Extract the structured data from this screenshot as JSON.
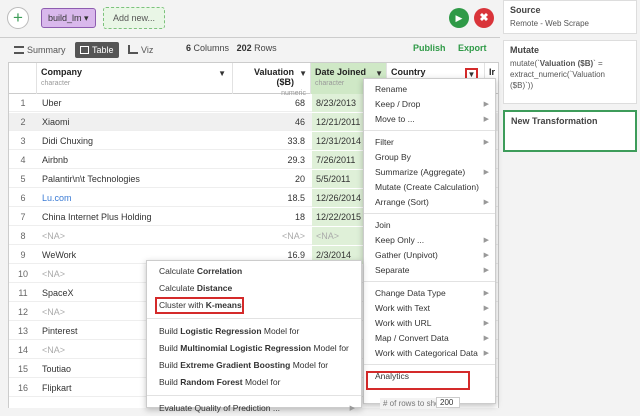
{
  "toolbar": {
    "plus": "+",
    "branch": "build_lm ▾",
    "add_new": "Add new...",
    "run": "▶",
    "stop": "✖"
  },
  "tabs": {
    "summary": "Summary",
    "table": "Table",
    "viz": "Viz",
    "columns_count": "6",
    "columns_label": "Columns",
    "rows_count": "202",
    "rows_label": "Rows",
    "publish": "Publish",
    "export": "Export"
  },
  "columns": [
    {
      "name": "Company",
      "type": "character"
    },
    {
      "name": "Valuation ($B)",
      "type": "numeric"
    },
    {
      "name": "Date Joined",
      "type": "character"
    },
    {
      "name": "Country",
      "type": ""
    },
    {
      "name": "Ir",
      "type": ""
    }
  ],
  "rows": [
    {
      "n": "1",
      "company": "Uber",
      "valuation": "68",
      "date": "8/23/2013"
    },
    {
      "n": "2",
      "company": "Xiaomi",
      "valuation": "46",
      "date": "12/21/2011"
    },
    {
      "n": "3",
      "company": "Didi Chuxing",
      "valuation": "33.8",
      "date": "12/31/2014"
    },
    {
      "n": "4",
      "company": "Airbnb",
      "valuation": "29.3",
      "date": "7/26/2011"
    },
    {
      "n": "5",
      "company": "Palantir\\n\\t  Technologies",
      "valuation": "20",
      "date": "5/5/2011"
    },
    {
      "n": "6",
      "company": "Lu.com",
      "valuation": "18.5",
      "date": "12/26/2014"
    },
    {
      "n": "7",
      "company": "China Internet Plus Holding",
      "valuation": "18",
      "date": "12/22/2015"
    },
    {
      "n": "8",
      "company": "<NA>",
      "valuation": "<NA>",
      "date": "<NA>"
    },
    {
      "n": "9",
      "company": "WeWork",
      "valuation": "16.9",
      "date": "2/3/2014"
    },
    {
      "n": "10",
      "company": "<NA>",
      "valuation": "",
      "date": ""
    },
    {
      "n": "11",
      "company": "SpaceX",
      "valuation": "",
      "date": ""
    },
    {
      "n": "12",
      "company": "<NA>",
      "valuation": "",
      "date": ""
    },
    {
      "n": "13",
      "company": "Pinterest",
      "valuation": "",
      "date": ""
    },
    {
      "n": "14",
      "company": "<NA>",
      "valuation": "",
      "date": ""
    },
    {
      "n": "15",
      "company": "Toutiao",
      "valuation": "",
      "date": ""
    },
    {
      "n": "16",
      "company": "Flipkart",
      "valuation": "",
      "date": ""
    }
  ],
  "right_panel": {
    "source_title": "Source",
    "source_body": "Remote - Web Scrape",
    "mutate_title": "Mutate",
    "mutate_prefix": "mutate(`",
    "mutate_bold": "Valuation ($B)",
    "mutate_suffix": "` = extract_numeric(`Valuation ($B)`))",
    "new_title": "New Transformation"
  },
  "column_menu": [
    {
      "label": "Rename",
      "arrow": false
    },
    {
      "label": "Keep / Drop",
      "arrow": true
    },
    {
      "label": "Move to ...",
      "arrow": true
    },
    {
      "sep": true
    },
    {
      "label": "Filter",
      "arrow": true
    },
    {
      "label": "Group By",
      "arrow": false
    },
    {
      "label": "Summarize (Aggregate)",
      "arrow": true
    },
    {
      "label": "Mutate (Create Calculation)",
      "arrow": false
    },
    {
      "label": "Arrange (Sort)",
      "arrow": true
    },
    {
      "sep": true
    },
    {
      "label": "Join",
      "arrow": false
    },
    {
      "label": "Keep Only ...",
      "arrow": true
    },
    {
      "label": "Gather (Unpivot)",
      "arrow": true
    },
    {
      "label": "Separate",
      "arrow": true
    },
    {
      "sep": true
    },
    {
      "label": "Change Data Type",
      "arrow": true
    },
    {
      "label": "Work with Text",
      "arrow": true
    },
    {
      "label": "Work with URL",
      "arrow": true
    },
    {
      "label": "Map / Convert Data",
      "arrow": true
    },
    {
      "label": "Work with Categorical Data",
      "arrow": true
    },
    {
      "sep": true
    },
    {
      "label": "Analytics",
      "arrow": false
    }
  ],
  "analytics_menu": [
    {
      "pre": "Calculate ",
      "bold": "Correlation",
      "post": ""
    },
    {
      "pre": "Calculate ",
      "bold": "Distance",
      "post": ""
    },
    {
      "pre": "Cluster with ",
      "bold": "K-means",
      "post": ""
    },
    {
      "sep": true
    },
    {
      "pre": "Build ",
      "bold": "Logistic Regression",
      "post": " Model for"
    },
    {
      "pre": "Build ",
      "bold": "Multinomial Logistic Regression",
      "post": " Model for"
    },
    {
      "pre": "Build ",
      "bold": "Extreme Gradient Boosting",
      "post": " Model for"
    },
    {
      "pre": "Build ",
      "bold": "Random Forest",
      "post": " Model for"
    },
    {
      "sep": true
    },
    {
      "pre": "Evaluate Quality of Prediction ...",
      "bold": "",
      "post": ""
    }
  ],
  "footer": {
    "rows_to_show": "# of rows to show",
    "rows_value": "200"
  },
  "colors": {
    "accent_green": "#2f9a47",
    "highlight_red": "#d42a2a",
    "date_column": "#dff0d8",
    "branch_purple": "#d9b8ec"
  }
}
